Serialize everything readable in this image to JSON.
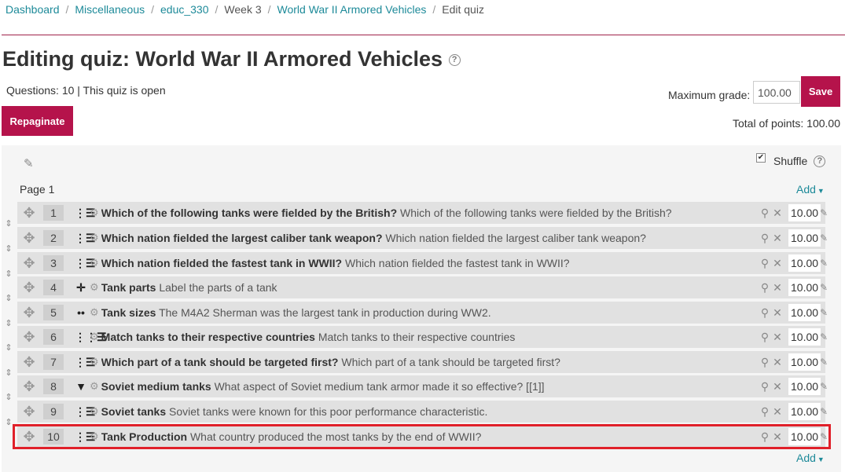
{
  "breadcrumb": [
    "Dashboard",
    "Miscellaneous",
    "educ_330",
    "Week 3",
    "World War II Armored Vehicles",
    "Edit quiz"
  ],
  "title": "Editing quiz: World War II Armored Vehicles",
  "quiz_info": "Questions: 10 | This quiz is open",
  "repaginate_label": "Repaginate",
  "max_grade_label": "Maximum grade:",
  "max_grade_value": "100.00",
  "save_label": "Save",
  "total_points": "Total of points: 100.00",
  "shuffle_label": "Shuffle",
  "shuffle_checked": true,
  "page_label": "Page 1",
  "add_label": "Add",
  "questions": [
    {
      "slot": "1",
      "type_icon": "multichoice-icon",
      "name": "Which of the following tanks were fielded by the British?",
      "text": "Which of the following tanks were fielded by the British?",
      "mark": "10.00"
    },
    {
      "slot": "2",
      "type_icon": "multichoice-icon",
      "name": "Which nation fielded the largest caliber tank weapon?",
      "text": "Which nation fielded the largest caliber tank weapon?",
      "mark": "10.00"
    },
    {
      "slot": "3",
      "type_icon": "multichoice-icon",
      "name": "Which nation fielded the fastest tank in WWII?",
      "text": "Which nation fielded the fastest tank in WWII?",
      "mark": "10.00"
    },
    {
      "slot": "4",
      "type_icon": "drag-drop-markers-icon",
      "name": "Tank parts",
      "text": "Label the parts of a tank",
      "mark": "10.00"
    },
    {
      "slot": "5",
      "type_icon": "true-false-icon",
      "name": "Tank sizes",
      "text": "The M4A2 Sherman was the largest tank in production during WW2.",
      "mark": "10.00"
    },
    {
      "slot": "6",
      "type_icon": "matching-icon",
      "name": "Match tanks to their respective countries",
      "text": "Match tanks to their respective countries",
      "mark": "10.00"
    },
    {
      "slot": "7",
      "type_icon": "multichoice-icon",
      "name": "Which part of a tank should be targeted first?",
      "text": "Which part of a tank should be targeted first?",
      "mark": "10.00"
    },
    {
      "slot": "8",
      "type_icon": "select-missing-words-icon",
      "name": "Soviet medium tanks",
      "text": "What aspect of Soviet medium tank armor made it so effective? [[1]]",
      "mark": "10.00"
    },
    {
      "slot": "9",
      "type_icon": "multichoice-icon",
      "name": "Soviet tanks",
      "text": "Soviet tanks were known for this poor performance characteristic.",
      "mark": "10.00"
    },
    {
      "slot": "10",
      "type_icon": "multichoice-icon",
      "name": "Tank Production",
      "text": "What country produced the most tanks by the end of WWII?",
      "mark": "10.00"
    }
  ],
  "colors": {
    "accent": "#b5134b",
    "link": "#1d8a99",
    "highlight": "#e0202a"
  }
}
